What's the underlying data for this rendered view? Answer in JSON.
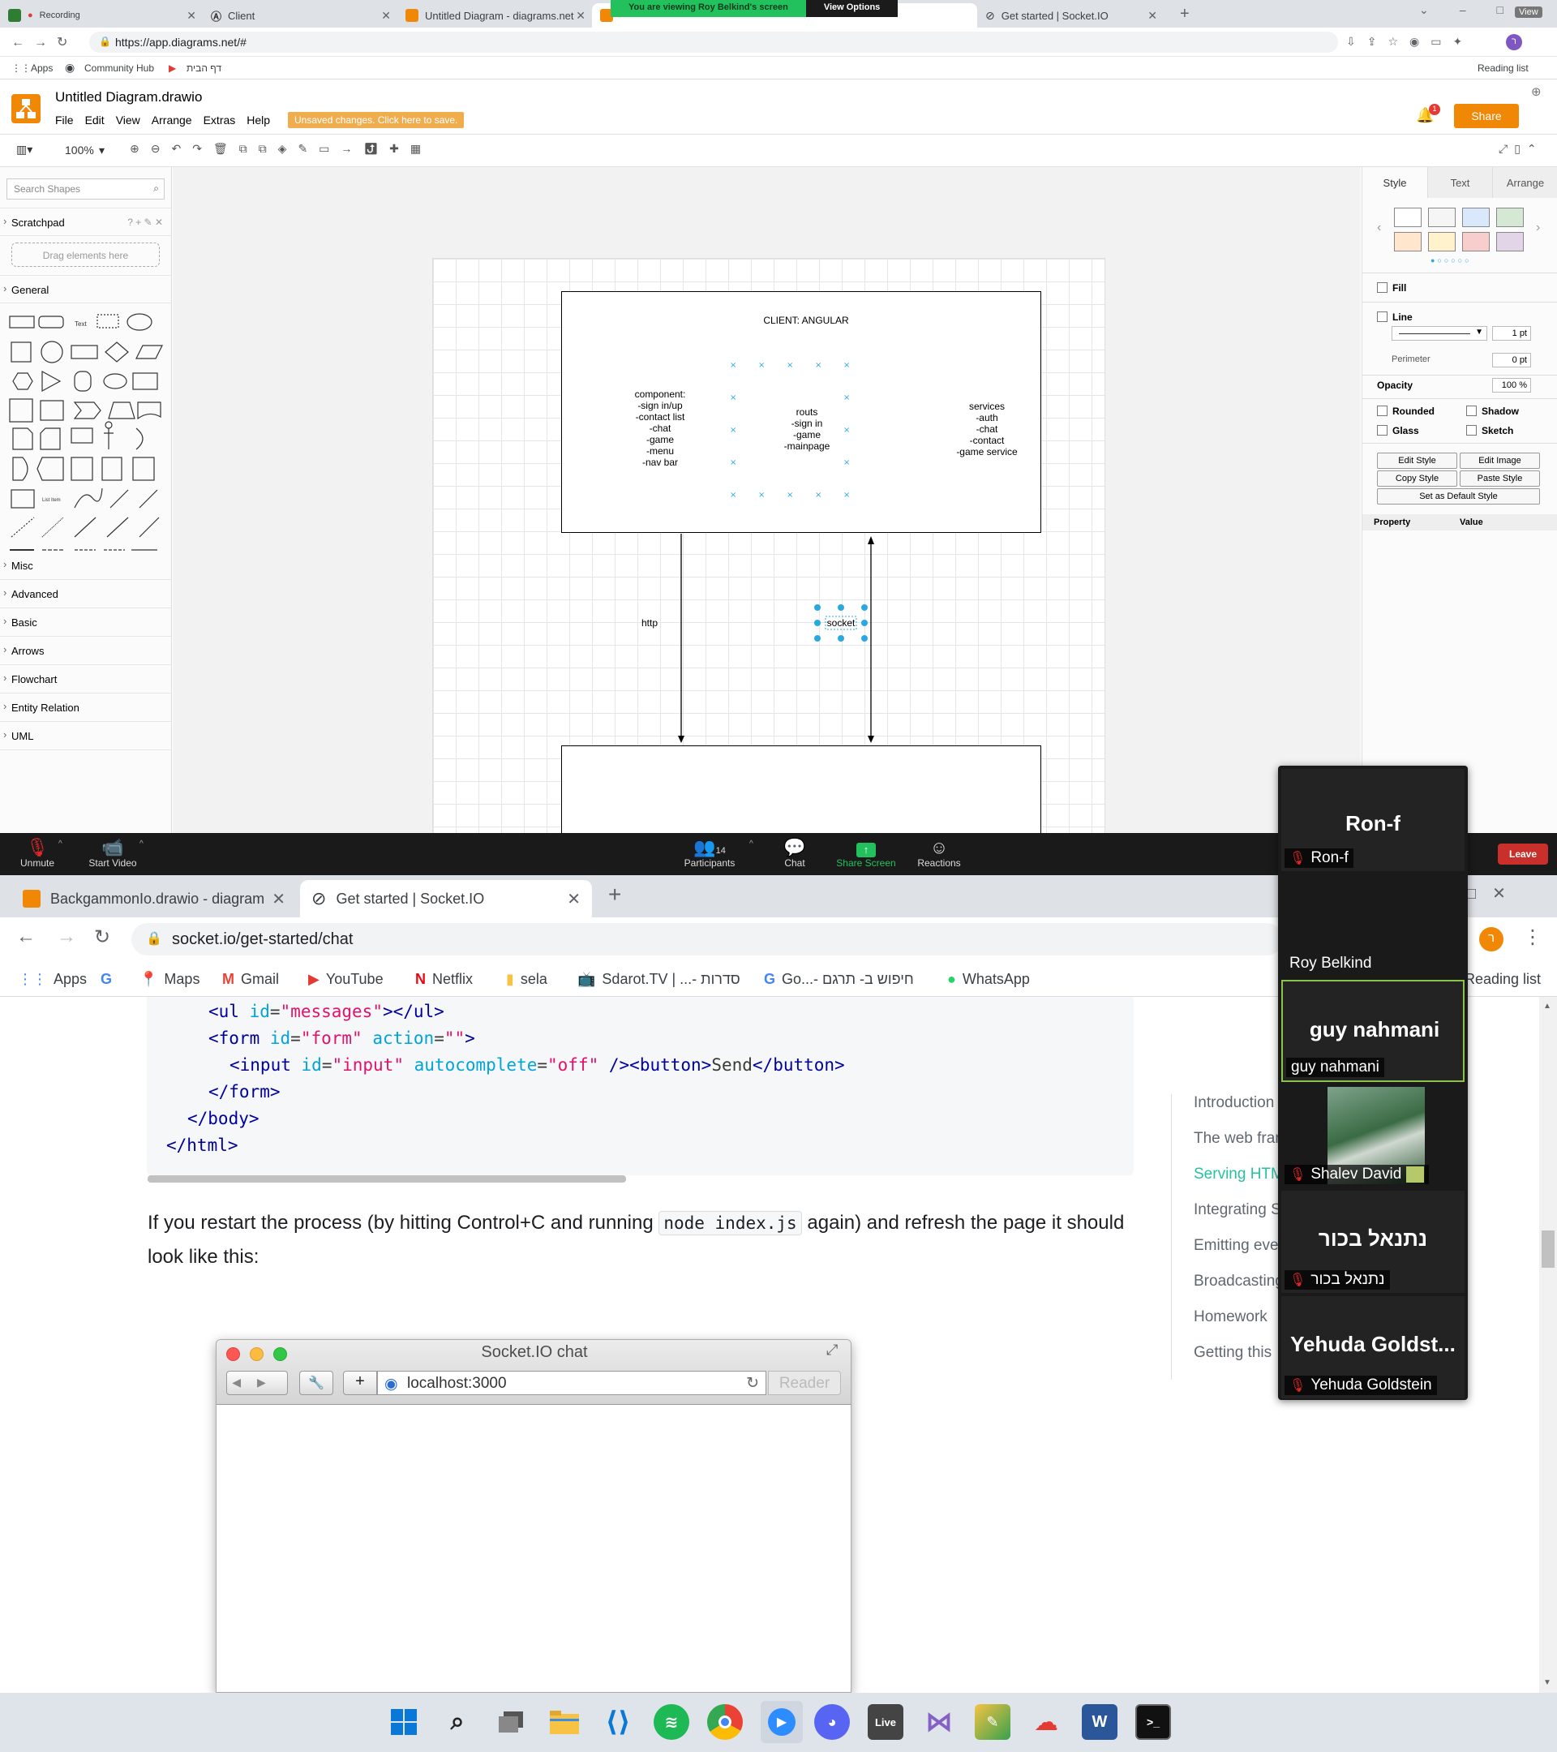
{
  "shared_screen": {
    "tabs": [
      {
        "label": "Client",
        "badge": "Recording"
      },
      {
        "label": "Client"
      },
      {
        "label": "Untitled Diagram - diagrams.net"
      },
      {
        "label": "Untitled Diagram - diagrams.net"
      },
      {
        "label": "Get started | Socket.IO"
      }
    ],
    "viewing_banner": "You are viewing Roy Belkind's screen",
    "view_options": "View Options",
    "view_label": "View",
    "url": "https://app.diagrams.net/#",
    "bookmarks": [
      "Apps",
      "Community Hub",
      "דף הבית"
    ],
    "reading_list": "Reading list",
    "drawio": {
      "title": "Untitled Diagram.drawio",
      "menu": [
        "File",
        "Edit",
        "View",
        "Arrange",
        "Extras",
        "Help"
      ],
      "unsaved": "Unsaved changes. Click here to save.",
      "share": "Share",
      "notifications": "1",
      "zoom": "100%",
      "search_placeholder": "Search Shapes",
      "scratchpad": "Scratchpad",
      "scratchpad_hint": "Drag elements here",
      "general": "General",
      "sections": [
        "Misc",
        "Advanced",
        "Basic",
        "Arrows",
        "Flowchart",
        "Entity Relation",
        "UML"
      ],
      "diagram": {
        "client_title": "CLIENT: ANGULAR",
        "component_text": "component:\n-sign in/up\n-contact list\n-chat\n-game\n-menu\n-nav bar",
        "routs_text": "routs\n-sign in\n-game\n-mainpage",
        "services_text": "services\n-auth\n-chat\n-contact\n-game service",
        "http_label": "http",
        "socket_label": "socket"
      },
      "format_panel": {
        "tabs": [
          "Style",
          "Text",
          "Arrange"
        ],
        "fill": "Fill",
        "line": "Line",
        "line_width": "1 pt",
        "perimeter": "Perimeter",
        "perimeter_value": "0 pt",
        "opacity": "Opacity",
        "opacity_value": "100 %",
        "rounded": "Rounded",
        "shadow": "Shadow",
        "glass": "Glass",
        "sketch": "Sketch",
        "edit_style": "Edit Style",
        "edit_image": "Edit Image",
        "copy_style": "Copy Style",
        "paste_style": "Paste Style",
        "set_default": "Set as Default Style",
        "property": "Property",
        "value": "Value",
        "swatches": [
          "#ffffff",
          "#f5f5f5",
          "#dae8fc",
          "#d5e8d4",
          "#ffe6cc",
          "#fff2cc",
          "#f8cecc",
          "#e1d5e7"
        ]
      }
    }
  },
  "zoom": {
    "unmute": "Unmute",
    "start_video": "Start Video",
    "participants": "Participants",
    "participant_count": "14",
    "chat": "Chat",
    "share_screen": "Share Screen",
    "reactions": "Reactions",
    "leave": "Leave"
  },
  "participants": [
    {
      "big": "Ron-f",
      "name": "Ron-f"
    },
    {
      "big": "",
      "name": "Roy Belkind"
    },
    {
      "big": "guy nahmani",
      "name": "guy nahmani"
    },
    {
      "big": "",
      "name": "Shalev David"
    },
    {
      "big": "נתנאל בכור",
      "name": "נתנאל בכור"
    },
    {
      "big": "Yehuda  Goldst...",
      "name": "Yehuda Goldstein"
    }
  ],
  "browser": {
    "tabs": [
      "BackgammonIo.drawio - diagram",
      "Get started | Socket.IO"
    ],
    "url": "socket.io/get-started/chat",
    "avatar": "ר",
    "bookmarks": [
      "Apps",
      "Maps",
      "Gmail",
      "YouTube",
      "Netflix",
      "sela",
      "Sdarot.TV | ...- סדרות",
      "Go...- חיפוש ב- תרגם",
      "WhatsApp"
    ],
    "reading_list": "Reading list",
    "code_lines": [
      {
        "indent": 2,
        "parts": [
          [
            "t",
            "<ul "
          ],
          [
            "a",
            "id"
          ],
          [
            "p",
            "="
          ],
          [
            "s",
            "\"messages\""
          ],
          [
            "t",
            "></ul>"
          ]
        ]
      },
      {
        "indent": 2,
        "parts": [
          [
            "t",
            "<form "
          ],
          [
            "a",
            "id"
          ],
          [
            "p",
            "="
          ],
          [
            "s",
            "\"form\""
          ],
          [
            "p",
            " "
          ],
          [
            "a",
            "action"
          ],
          [
            "p",
            "="
          ],
          [
            "s",
            "\"\""
          ],
          [
            "t",
            ">"
          ]
        ]
      },
      {
        "indent": 3,
        "parts": [
          [
            "t",
            "<input "
          ],
          [
            "a",
            "id"
          ],
          [
            "p",
            "="
          ],
          [
            "s",
            "\"input\""
          ],
          [
            "p",
            " "
          ],
          [
            "a",
            "autocomplete"
          ],
          [
            "p",
            "="
          ],
          [
            "s",
            "\"off\""
          ],
          [
            "p",
            " "
          ],
          [
            "t",
            "/><button>"
          ],
          [
            "p",
            "Send"
          ],
          [
            "t",
            "</button>"
          ]
        ]
      },
      {
        "indent": 2,
        "parts": [
          [
            "t",
            "</form>"
          ]
        ]
      },
      {
        "indent": 1,
        "parts": [
          [
            "t",
            "</body>"
          ]
        ]
      },
      {
        "indent": 0,
        "parts": [
          [
            "t",
            "</html>"
          ]
        ]
      }
    ],
    "paragraph_before": "If you restart the process (by hitting Control+C and running ",
    "paragraph_code": "node index.js",
    "paragraph_after": " again) and refresh the page it should look like this:",
    "mac_window": {
      "title": "Socket.IO chat",
      "url": "localhost:3000",
      "reader": "Reader"
    },
    "toc": [
      "Introduction",
      "The web fran",
      "Serving HTM",
      "Integrating S",
      "Emitting eve",
      "Broadcasting",
      "Homework",
      "Getting this"
    ],
    "toc_active_index": 2
  },
  "taskbar": [
    "start",
    "search",
    "task-view",
    "file-explorer",
    "vscode",
    "spotify",
    "chrome",
    "zoom",
    "discord",
    "live",
    "visual-studio",
    "paint",
    "ccleaner",
    "word",
    "terminal"
  ]
}
